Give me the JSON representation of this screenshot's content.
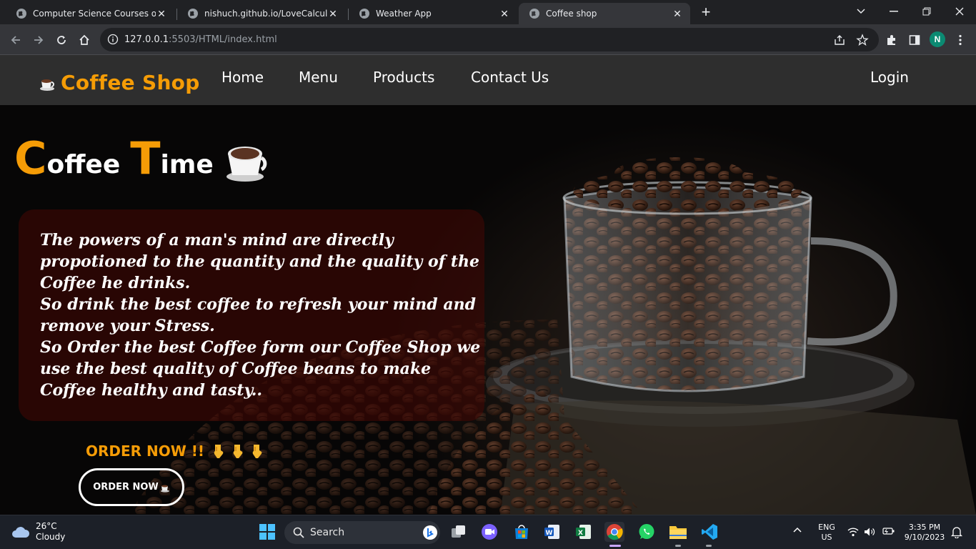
{
  "browser": {
    "tabs": [
      {
        "title": "Computer Science Courses on Le",
        "active": false
      },
      {
        "title": "nishuch.github.io/LoveCalculator",
        "active": false
      },
      {
        "title": "Weather App",
        "active": false
      },
      {
        "title": "Coffee shop",
        "active": true
      }
    ],
    "url_host": "127.0.0.1",
    "url_path": ":5503/HTML/index.html",
    "profile_initial": "N"
  },
  "site": {
    "brand": "Coffee Shop",
    "nav": [
      "Home",
      "Menu",
      "Products",
      "Contact Us"
    ],
    "login": "Login"
  },
  "hero": {
    "title_c": "C",
    "title_rest1": "offee",
    "title_t": "T",
    "title_rest2": "ime",
    "quote_lines": [
      "The powers of a man's mind are directly",
      "propotioned to the quantity and the quality of the",
      "Coffee he drinks.",
      "So drink the best coffee to refresh your mind and",
      "remove your Stress.",
      "So Order the best Coffee form our Coffee Shop we",
      "use the best quality of Coffee beans to make",
      "Coffee healthy and tasty.."
    ],
    "order_heading": "ORDER NOW !!",
    "order_button": "ORDER NOW"
  },
  "taskbar": {
    "temperature": "26°C",
    "condition": "Cloudy",
    "search_placeholder": "Search",
    "lang_top": "ENG",
    "lang_bottom": "US",
    "time": "3:35 PM",
    "date": "9/10/2023"
  },
  "colors": {
    "accent": "#f59c06",
    "header_bg": "#2e2e2e",
    "quote_box": "rgba(70,8,4,0.55)"
  }
}
